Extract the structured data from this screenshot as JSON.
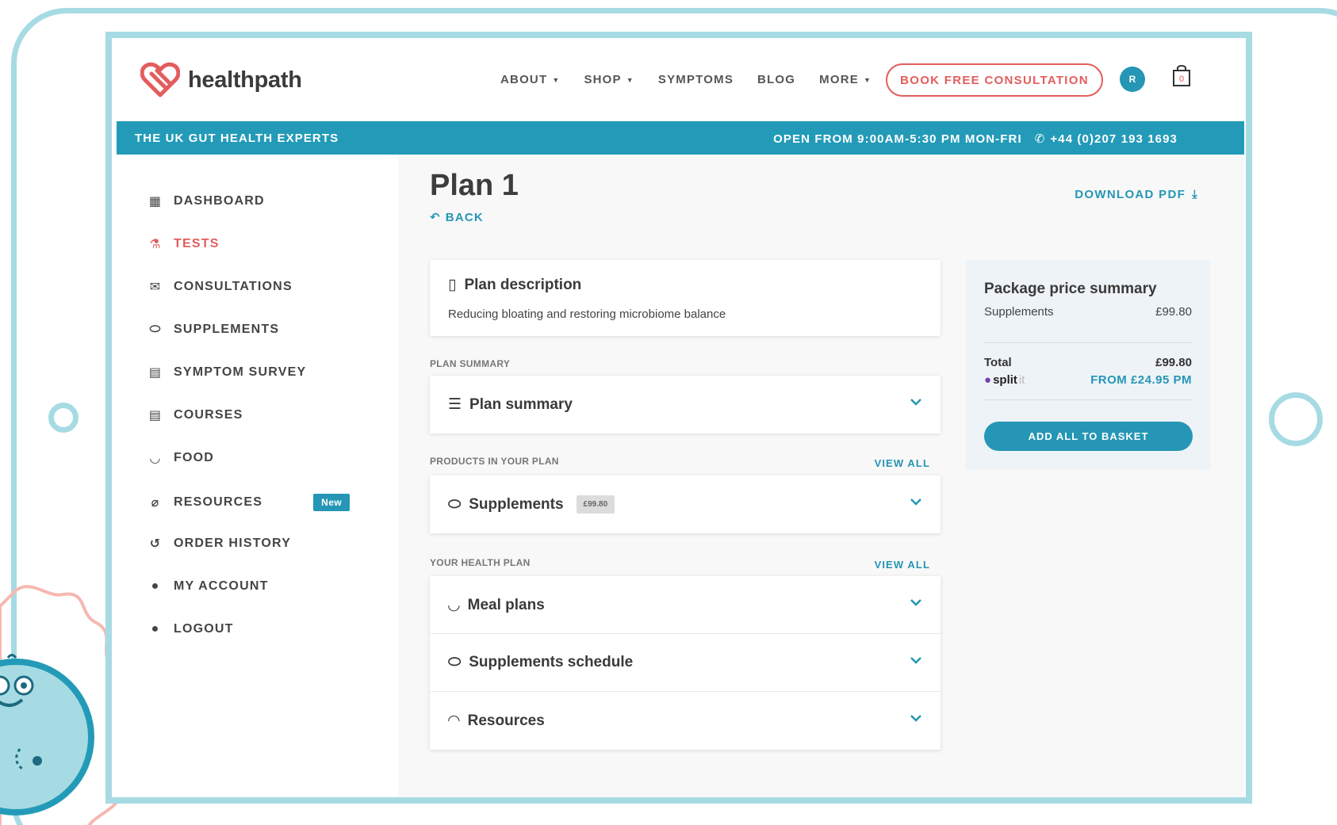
{
  "brand": {
    "name": "healthpath",
    "accent": "#2596b5",
    "cta_color": "#e35d5d"
  },
  "nav": {
    "items": [
      {
        "label": "ABOUT",
        "has_dropdown": true
      },
      {
        "label": "SHOP",
        "has_dropdown": true
      },
      {
        "label": "SYMPTOMS",
        "has_dropdown": false
      },
      {
        "label": "BLOG",
        "has_dropdown": false
      },
      {
        "label": "MORE",
        "has_dropdown": true
      }
    ],
    "cta": "BOOK FREE CONSULTATION",
    "avatar_initial": "R",
    "basket_count": "0"
  },
  "banner": {
    "left": "THE UK GUT HEALTH EXPERTS",
    "hours": "OPEN FROM 9:00AM-5:30 PM MON-FRI",
    "phone": "+44 (0)207 193 1693"
  },
  "sidebar": {
    "items": [
      {
        "label": "DASHBOARD",
        "icon": "dashboard-icon",
        "active": false
      },
      {
        "label": "TESTS",
        "icon": "flask-icon",
        "active": true
      },
      {
        "label": "CONSULTATIONS",
        "icon": "chat-icon",
        "active": false
      },
      {
        "label": "SUPPLEMENTS",
        "icon": "pill-icon",
        "active": false
      },
      {
        "label": "SYMPTOM SURVEY",
        "icon": "clipboard-icon",
        "active": false
      },
      {
        "label": "COURSES",
        "icon": "clipboard-icon",
        "active": false
      },
      {
        "label": "FOOD",
        "icon": "bowl-icon",
        "active": false
      },
      {
        "label": "RESOURCES",
        "icon": "paperclip-icon",
        "active": false,
        "badge": "New"
      },
      {
        "label": "ORDER HISTORY",
        "icon": "history-icon",
        "active": false
      },
      {
        "label": "MY ACCOUNT",
        "icon": "user-icon",
        "active": false
      },
      {
        "label": "LOGOUT",
        "icon": "user-icon",
        "active": false
      }
    ]
  },
  "page": {
    "title": "Plan 1",
    "back": "BACK",
    "download": "DOWNLOAD PDF"
  },
  "plan_description": {
    "title": "Plan description",
    "text": "Reducing bloating and restoring microbiome balance"
  },
  "sections": {
    "plan_summary_label": "PLAN SUMMARY",
    "plan_summary_title": "Plan summary",
    "products_label": "PRODUCTS IN YOUR PLAN",
    "products_view_all": "VIEW ALL",
    "supplements_title": "Supplements",
    "supplements_price": "£99.80",
    "health_plan_label": "YOUR HEALTH PLAN",
    "health_plan_view_all": "VIEW ALL",
    "health_plan_items": [
      "Meal plans",
      "Supplements schedule",
      "Resources"
    ]
  },
  "summary": {
    "title": "Package price summary",
    "line_label": "Supplements",
    "line_value": "£99.80",
    "total_label": "Total",
    "total_value": "£99.80",
    "splitit_label": "split",
    "splitit_suffix": "it",
    "splitit_value": "FROM £24.95 PM",
    "button": "ADD ALL TO BASKET"
  }
}
